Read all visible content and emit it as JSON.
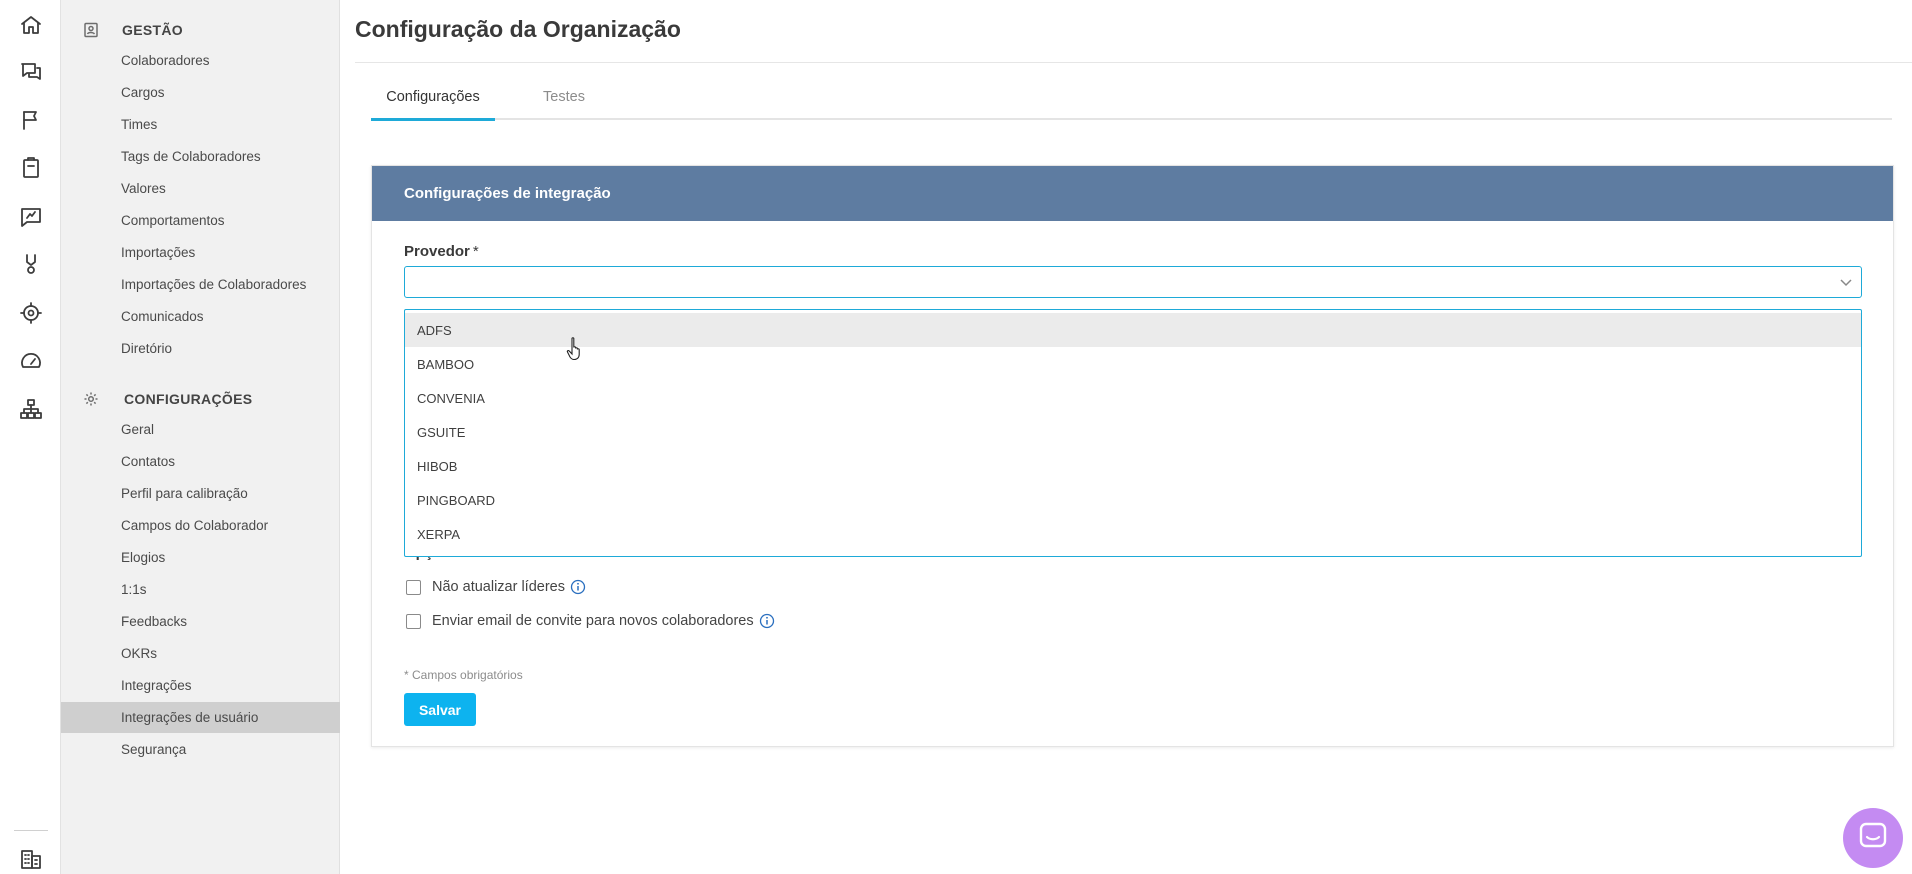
{
  "rail": {
    "icons": [
      "home-icon",
      "chat-icon",
      "flag-icon",
      "clipboard-icon",
      "feedback-icon",
      "medal-icon",
      "target-icon",
      "gauge-icon",
      "org-chart-icon",
      "building-icon"
    ]
  },
  "sidebar": {
    "sections": [
      {
        "title": "GESTÃO",
        "icon": "contact-card-icon",
        "items": [
          "Colaboradores",
          "Cargos",
          "Times",
          "Tags de Colaboradores",
          "Valores",
          "Comportamentos",
          "Importações",
          "Importações de Colaboradores",
          "Comunicados",
          "Diretório"
        ]
      },
      {
        "title": "CONFIGURAÇÕES",
        "icon": "gear-icon",
        "items": [
          "Geral",
          "Contatos",
          "Perfil para calibração",
          "Campos do Colaborador",
          "Elogios",
          "1:1s",
          "Feedbacks",
          "OKRs",
          "Integrações",
          "Integrações de usuário",
          "Segurança"
        ]
      }
    ],
    "active_item": "Integrações de usuário"
  },
  "page": {
    "title": "Configuração da Organização"
  },
  "tabs": [
    {
      "label": "Configurações",
      "active": true
    },
    {
      "label": "Testes",
      "active": false
    }
  ],
  "card": {
    "header": "Configurações de integração",
    "provider_label": "Provedor",
    "required_mark": "*",
    "provider_value": "",
    "dropdown_options": [
      "ADFS",
      "BAMBOO",
      "CONVENIA",
      "GSUITE",
      "HIBOB",
      "PINGBOARD",
      "XERPA"
    ],
    "hovered_option": "ADFS",
    "options_label": "Opções",
    "checkboxes": [
      {
        "label": "Não atualizar líderes",
        "checked": false
      },
      {
        "label": "Enviar email de convite para novos colaboradores",
        "checked": false
      }
    ],
    "required_note": "* Campos obrigatórios",
    "save_label": "Salvar"
  },
  "colors": {
    "accent": "#1eaad8",
    "save_button": "#0db3ef",
    "card_header": "#5e7ca1",
    "chat_bubble": "#c48bf2",
    "sidebar_bg": "#f1f1f1",
    "active_nav": "#cfcfcf"
  }
}
